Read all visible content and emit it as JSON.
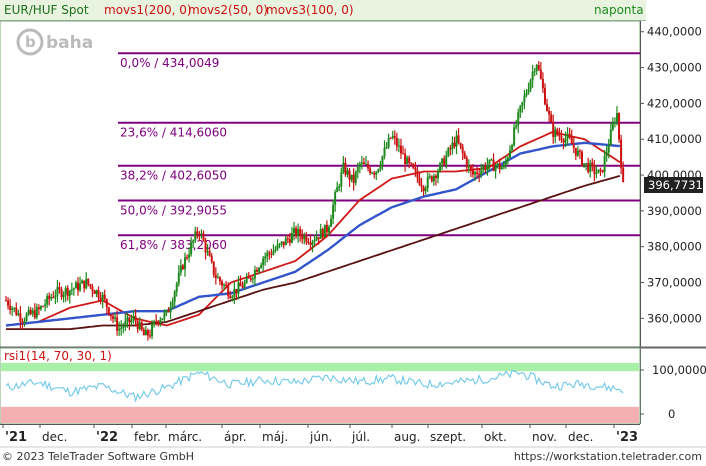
{
  "header": {
    "symbol": "EUR/HUF Spot",
    "ma1": "movs1(200, 0)",
    "ma2": "movs2(50, 0)",
    "ma3": "movs3(100, 0)",
    "period": "naponta",
    "logo_text": "baha"
  },
  "footer": {
    "copyright": "© 2023 TeleTrader Software GmbH",
    "url": "https://workstation.teletrader.com"
  },
  "colors": {
    "price": "#1e8a1e",
    "price_down": "#cc1010",
    "ma50": "#d01818",
    "ma100": "#3355cc",
    "ma200": "#5a1010",
    "fib": "#800080",
    "rsi_line": "#70c8e8",
    "rsi_upper_band": "#a8f0a8",
    "rsi_lower_band": "#f4b0b0"
  },
  "chart_data": [
    {
      "type": "line",
      "title": "EUR/HUF Spot",
      "x_tick_labels": [
        "'21",
        "dec.",
        "'22",
        "febr.",
        "márc.",
        "ápr.",
        "máj.",
        "jún.",
        "júl.",
        "aug.",
        "szept.",
        "okt.",
        "nov.",
        "dec.",
        "'23"
      ],
      "y_tick_labels": [
        "360,0000",
        "370,0000",
        "380,0000",
        "390,0000",
        "400,0000",
        "410,0000",
        "420,0000",
        "430,0000",
        "440,0000"
      ],
      "ylim": [
        352,
        443
      ],
      "last_value_label": "396,7731",
      "fib_levels": [
        {
          "label": "0,0% / 434,0049",
          "value": 434.0049
        },
        {
          "label": "23,6% / 414,6060",
          "value": 414.606
        },
        {
          "label": "38,2% / 402,6050",
          "value": 402.605
        },
        {
          "label": "50,0% / 392,9055",
          "value": 392.9055
        },
        {
          "label": "61,8% / 383,2060",
          "value": 383.206
        }
      ],
      "series": [
        {
          "name": "EUR/HUF Spot",
          "x_month_index": [
            0,
            0.5,
            1,
            1.5,
            2,
            2.5,
            3,
            3.5,
            4,
            4.3,
            4.5,
            4.7,
            5,
            5.5,
            6,
            6.5,
            7,
            7.5,
            8,
            8.5,
            9,
            9.5,
            10,
            10.3,
            10.5,
            10.8,
            11,
            11.5,
            12,
            12.5,
            13,
            13.5,
            14,
            14.5,
            15,
            15.5,
            16,
            16.5,
            17,
            17.5,
            18,
            18.5,
            19,
            19.2
          ],
          "values": [
            365,
            360,
            362,
            367,
            368,
            370,
            366,
            357,
            360,
            355,
            356,
            360,
            361,
            375,
            385,
            372,
            367,
            370,
            377,
            380,
            384,
            382,
            385,
            396,
            402,
            398,
            403,
            401,
            411,
            403,
            397,
            402,
            410,
            400,
            403,
            402,
            418,
            432,
            412,
            410,
            403,
            400,
            418,
            396.7731
          ]
        },
        {
          "name": "movs2(50, 0)",
          "x_month_index": [
            0,
            1,
            2,
            3,
            4,
            5,
            6,
            7,
            8,
            9,
            10,
            11,
            12,
            13,
            14,
            15,
            16,
            17,
            18,
            19.2
          ],
          "values": [
            358,
            359,
            363,
            365,
            360,
            358,
            361,
            370,
            373,
            376,
            383,
            393,
            399,
            401,
            401,
            402,
            408,
            412,
            410,
            403
          ]
        },
        {
          "name": "movs3(100, 0)",
          "x_month_index": [
            0,
            1,
            2,
            3,
            4,
            5,
            6,
            7,
            8,
            9,
            10,
            11,
            12,
            13,
            14,
            15,
            16,
            17,
            18,
            19.2
          ],
          "values": [
            358,
            359,
            360,
            361,
            362,
            362,
            366,
            367,
            370,
            373,
            379,
            386,
            391,
            394,
            396,
            401,
            406,
            408,
            409,
            408
          ]
        },
        {
          "name": "movs1(200, 0)",
          "x_month_index": [
            0,
            1,
            2,
            3,
            4,
            5,
            6,
            7,
            8,
            9,
            10,
            11,
            12,
            13,
            14,
            15,
            16,
            17,
            18,
            19.2
          ],
          "values": [
            357,
            357,
            357,
            358,
            358,
            359,
            362,
            365,
            368,
            370,
            373,
            376,
            379,
            382,
            385,
            388,
            391,
            394,
            397,
            400
          ]
        }
      ]
    },
    {
      "type": "line",
      "title": "rsi1(14, 70, 30, 1)",
      "y_tick_labels": [
        "100,0000",
        "0"
      ],
      "ylim": [
        0,
        100
      ],
      "band_upper": 70,
      "band_lower": 30,
      "series": [
        {
          "name": "rsi1(14, 70, 30, 1)",
          "x_month_index": [
            0,
            1,
            2,
            3,
            4,
            5,
            6,
            7,
            8,
            9,
            10,
            11,
            12,
            13,
            14,
            15,
            16,
            17,
            18,
            19.2
          ],
          "values": [
            48,
            55,
            42,
            50,
            35,
            48,
            68,
            52,
            58,
            55,
            62,
            56,
            60,
            52,
            55,
            60,
            68,
            50,
            53,
            45
          ]
        }
      ]
    }
  ]
}
